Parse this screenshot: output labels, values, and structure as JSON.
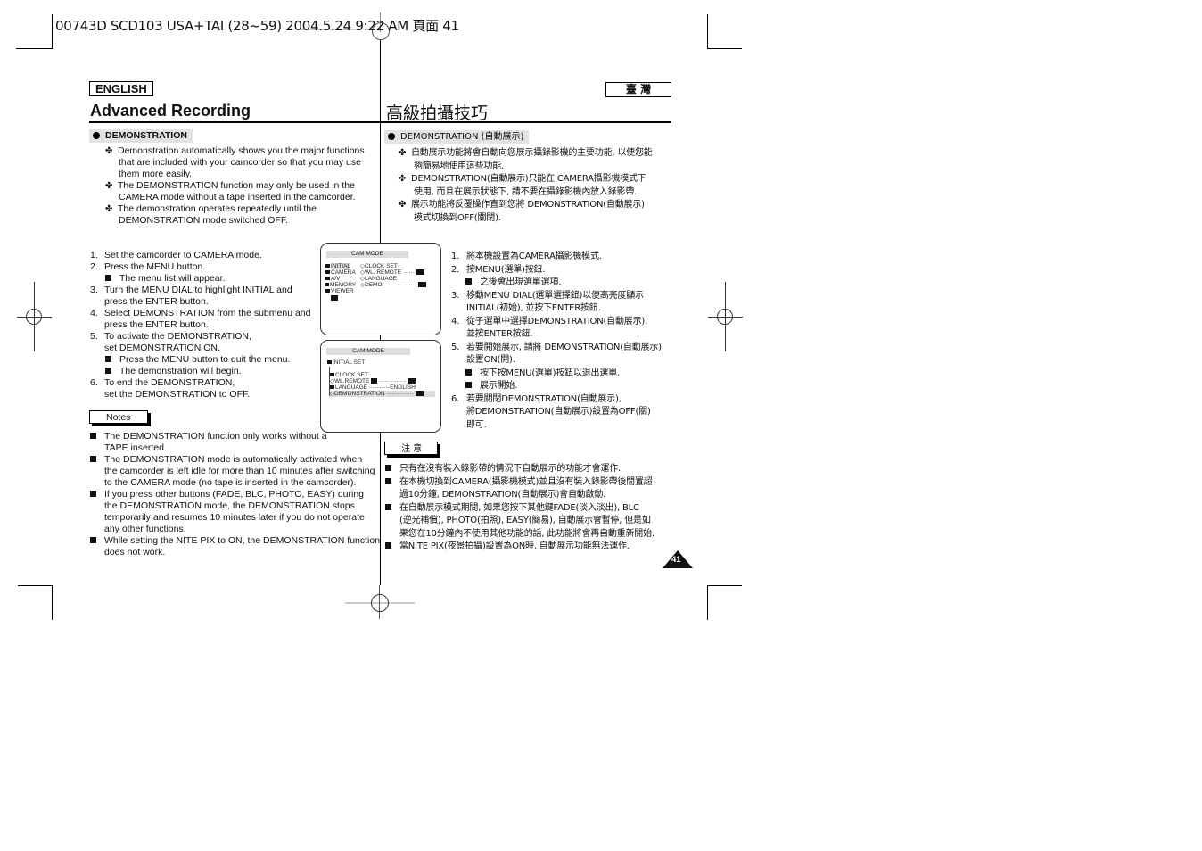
{
  "print_header": "00743D SCD103 USA+TAI (28~59)  2004.5.24  9:22 AM  頁面 41",
  "left": {
    "language_badge": "ENGLISH",
    "title": "Advanced Recording",
    "section_heading": "DEMONSTRATION",
    "intro_bullets": [
      [
        "Demonstration automatically shows you the major functions",
        "that are included with your camcorder so that you may use",
        "them more easily."
      ],
      [
        "The DEMONSTRATION function may only be used in the",
        "CAMERA mode without a tape inserted in the camcorder."
      ],
      [
        "The demonstration operates repeatedly until the",
        "DEMONSTRATION mode switched OFF."
      ]
    ],
    "steps": [
      {
        "num": "1.",
        "lines": [
          "Set the camcorder to CAMERA mode."
        ]
      },
      {
        "num": "2.",
        "lines": [
          "Press the MENU button."
        ],
        "subs": [
          "The menu list will appear."
        ]
      },
      {
        "num": "3.",
        "lines": [
          "Turn the MENU DIAL to highlight INITIAL and",
          "press the ENTER button."
        ]
      },
      {
        "num": "4.",
        "lines": [
          "Select DEMONSTRATION from the submenu and",
          "press the ENTER button."
        ]
      },
      {
        "num": "5.",
        "lines": [
          "To activate the DEMONSTRATION,",
          "set DEMONSTRATION ON."
        ],
        "subs": [
          "Press the MENU button to quit the menu.",
          "The demonstration will begin."
        ]
      },
      {
        "num": "6.",
        "lines": [
          "To end the DEMONSTRATION,",
          "set the DEMONSTRATION to OFF."
        ]
      }
    ],
    "notes_label": "Notes",
    "notes": [
      [
        "The DEMONSTRATION function only works without a",
        "TAPE inserted."
      ],
      [
        "The DEMONSTRATION mode is automatically activated when",
        "the camcorder is left idle for more than 10 minutes after switching",
        "to the CAMERA mode (no tape is inserted in the camcorder)."
      ],
      [
        "If you press other buttons (FADE, BLC, PHOTO, EASY) during",
        "the DEMONSTRATION mode, the DEMONSTRATION stops",
        "temporarily and resumes 10 minutes later if you do not operate",
        "any other functions."
      ],
      [
        "While setting the NITE PIX to ON, the DEMONSTRATION function",
        "does not work."
      ]
    ]
  },
  "right": {
    "language_badge": "臺  灣",
    "title": "高級拍攝技巧",
    "section_heading": "DEMONSTRATION (自動展示)",
    "intro_bullets": [
      [
        "自動展示功能將會自動向您展示攝錄影機的主要功能, 以便您能",
        "夠簡易地使用這些功能."
      ],
      [
        "DEMONSTRATION(自動展示)只能在 CAMERA攝影機模式下",
        "使用, 而且在展示狀態下, 請不要在攝錄影機內放入錄影帶."
      ],
      [
        "展示功能將反覆操作直到您將 DEMONSTRATION(自動展示)",
        "模式切換到OFF(關閉)."
      ]
    ],
    "steps": [
      {
        "num": "1.",
        "lines": [
          "將本機設置為CAMERA攝影機模式."
        ]
      },
      {
        "num": "2.",
        "lines": [
          "按MENU(選單)按鈕."
        ],
        "subs": [
          "之後會出現選單選項."
        ]
      },
      {
        "num": "3.",
        "lines": [
          "移動MENU DIAL(選單選擇鈕)以便高亮度顯示",
          "INITIAL(初始), 並按下ENTER按鈕."
        ]
      },
      {
        "num": "4.",
        "lines": [
          "從子選單中選擇DEMONSTRATION(自動展示),",
          "並按ENTER按鈕."
        ]
      },
      {
        "num": "5.",
        "lines": [
          "若要開始展示, 請將 DEMONSTRATION(自動展示)",
          "設置ON(開)."
        ],
        "subs": [
          "按下按MENU(選單)按鈕以退出選單.",
          "展示開始."
        ]
      },
      {
        "num": "6.",
        "lines": [
          "若要關閉DEMONSTRATION(自動展示),",
          "將DEMONSTRATION(自動展示)設置為OFF(關)",
          "即可."
        ]
      }
    ],
    "notes_label": "注 意",
    "notes": [
      [
        "只有在沒有裝入錄影帶的情況下自動展示的功能才會運作."
      ],
      [
        "在本機切換到CAMERA(攝影機模式)並且沒有裝入錄影帶後閒置超",
        "過10分鐘, DEMONSTRATION(自動展示)會自動啟動."
      ],
      [
        "在自動展示模式期間, 如果您按下其他鍵FADE(淡入淡出), BLC",
        "(逆光補償), PHOTO(拍照), EASY(簡易), 自動展示會暫停, 但是如",
        "果您在10分鐘內不使用其他功能的話, 此功能將會再自動重新開始."
      ],
      [
        "當NITE PIX(夜景拍攝)設置為ON時, 自動展示功能無法運作."
      ]
    ]
  },
  "osd1": {
    "title": "CAM MODE",
    "menu": [
      "INITIAL",
      "CAMERA",
      "A/V",
      "MEMORY",
      "VIEWER"
    ],
    "submenu": [
      "CLOCK SET",
      "WL. REMOTE",
      "LANGUAGE",
      "DEMO"
    ]
  },
  "osd2": {
    "title": "CAM MODE",
    "header": "INITIAL SET",
    "items": [
      "CLOCK  SET",
      "WL.REMOTE",
      "LANGUAGE",
      "DEMONSTRATION"
    ],
    "language_value": "ENGLISH",
    "dots_short": "··············",
    "dots_long": "····················"
  },
  "osd1_dots": {
    "short": "·······",
    "long": "··················"
  },
  "page_number": "41"
}
